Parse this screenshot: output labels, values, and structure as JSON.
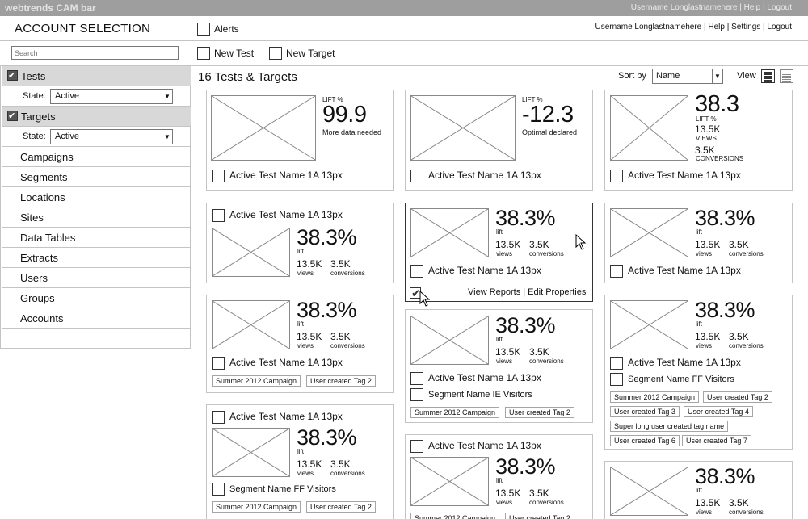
{
  "cam_bar": {
    "brand": "webtrends CAM bar",
    "links": "Username Longlastnamehere | Help | Logout"
  },
  "header": {
    "account_selection": "ACCOUNT SELECTION",
    "alerts_label": "Alerts",
    "user_links": "Username Longlastnamehere | Help | Settings | Logout"
  },
  "toolbar": {
    "search_placeholder": "Search",
    "new_test_label": "New Test",
    "new_target_label": "New Target"
  },
  "sidebar": {
    "tests_label": "Tests",
    "targets_label": "Targets",
    "state_label": "State:",
    "tests_state": "Active",
    "targets_state": "Active",
    "items": [
      "Campaigns",
      "Segments",
      "Locations",
      "Sites",
      "Data Tables",
      "Extracts",
      "Users",
      "Groups",
      "Accounts"
    ]
  },
  "content": {
    "title": "16 Tests & Targets",
    "sort_label": "Sort by",
    "sort_value": "Name",
    "view_label": "View"
  },
  "labels": {
    "lift_pct": "LIFT %",
    "lift": "lift",
    "views": "views",
    "conversions": "conversions",
    "views_caps": "VIEWS",
    "conversions_caps": "CONVERSIONS",
    "test_name": "Active Test Name 1A 13px",
    "actions": "View Reports | Edit Properties"
  },
  "cards": {
    "c1": {
      "value": "99.9",
      "note": "More data needed"
    },
    "c2": {
      "value": "-12.3",
      "note": "Optimal declared"
    },
    "c3": {
      "value": "38.3",
      "views": "13.5K",
      "conversions": "3.5K"
    },
    "std": {
      "value": "38.3%",
      "views": "13.5K",
      "conversions": "3.5K"
    },
    "segments": {
      "ff": "Segment Name FF Visitors",
      "ie": "Segment Name IE Visitors"
    },
    "tags": {
      "campaign": "Summer 2012 Campaign",
      "tag2": "User created Tag 2",
      "tag3": "User created Tag 3",
      "tag4": "User created Tag 4",
      "long": "Super long user created tag name",
      "tag6": "User created Tag 6",
      "tag7": "User created Tag 7"
    }
  }
}
